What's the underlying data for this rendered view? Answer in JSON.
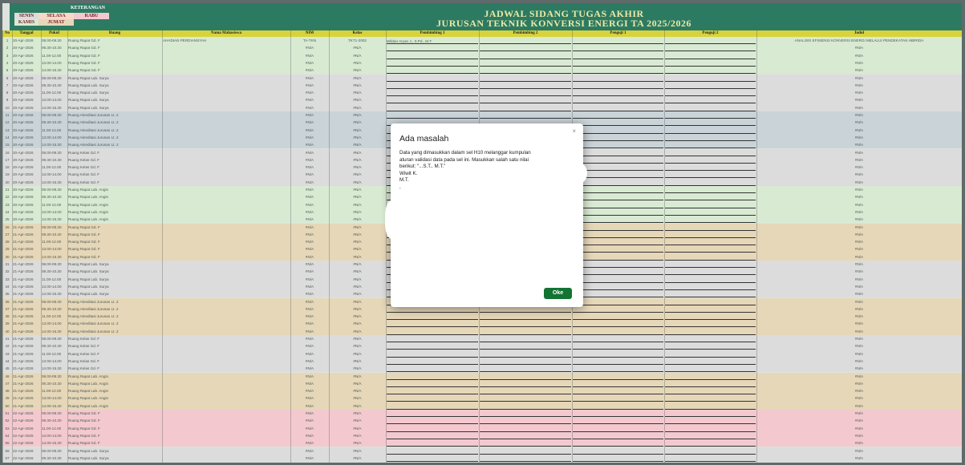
{
  "legend": {
    "title": "KETERANGAN",
    "days": [
      {
        "label": "SENIN",
        "color": "#dcdcdc"
      },
      {
        "label": "SELASA",
        "color": "#f6d9c7"
      },
      {
        "label": "RABU",
        "color": "#f3c9cf"
      },
      {
        "label": "KAMIS",
        "color": "#d9ead3"
      },
      {
        "label": "JUMAT",
        "color": "#e6d7b8"
      }
    ]
  },
  "sheet_title": {
    "line1": "JADWAL SIDANG TUGAS AKHIR",
    "line2": "JURUSAN TEKNIK KONVERSI ENERGI TA 2025/2026"
  },
  "columns": [
    "No",
    "Tanggal",
    "Pukul",
    "Ruang",
    "Nama Mahasiswa",
    "NIM",
    "Kelas",
    "Pembimbing 1",
    "Pembimbing 2",
    "Penguji 1",
    "Penguji 2",
    "Judul"
  ],
  "first_row": {
    "nama": "AHADIAN PERDIANSYAH",
    "nim": "TA-TKN",
    "kelas": "TKT1-2002",
    "pembimbing1": "Wildan Aryan J., S.Pd., M.T.",
    "judul": "ANALISIS EFISIENSI KONVERSI ENERGI MELALUI PENDEKATAN HIBRIDA"
  },
  "na_text": "#N/A",
  "rows": [
    {
      "no": "1",
      "tanggal": "20-Apr-2026",
      "pukul": "08.00-09.30",
      "ruang": "Ruang Rapat Gd. F",
      "color": "#d9ead3"
    },
    {
      "no": "2",
      "tanggal": "20-Apr-2026",
      "pukul": "09.30-10.30",
      "ruang": "Ruang Rapat Gd. F",
      "color": "#d9ead3"
    },
    {
      "no": "3",
      "tanggal": "20-Apr-2026",
      "pukul": "11.00-12.00",
      "ruang": "Ruang Rapat Gd. F",
      "color": "#d9ead3"
    },
    {
      "no": "4",
      "tanggal": "20-Apr-2026",
      "pukul": "13.00-14.00",
      "ruang": "Ruang Rapat Gd. F",
      "color": "#d9ead3"
    },
    {
      "no": "5",
      "tanggal": "20-Apr-2026",
      "pukul": "14.00-15.30",
      "ruang": "Ruang Rapat Gd. F",
      "color": "#d9ead3"
    },
    {
      "no": "6",
      "tanggal": "20-Apr-2026",
      "pukul": "08.00-09.30",
      "ruang": "Ruang Rapat Lab. Surya",
      "color": "#dcdcdc"
    },
    {
      "no": "7",
      "tanggal": "20-Apr-2026",
      "pukul": "09.30-10.30",
      "ruang": "Ruang Rapat Lab. Surya",
      "color": "#dcdcdc"
    },
    {
      "no": "8",
      "tanggal": "20-Apr-2026",
      "pukul": "11.00-12.00",
      "ruang": "Ruang Rapat Lab. Surya",
      "color": "#dcdcdc"
    },
    {
      "no": "9",
      "tanggal": "20-Apr-2026",
      "pukul": "13.00-14.00",
      "ruang": "Ruang Rapat Lab. Surya",
      "color": "#dcdcdc"
    },
    {
      "no": "10",
      "tanggal": "20-Apr-2026",
      "pukul": "14.00-15.30",
      "ruang": "Ruang Rapat Lab. Surya",
      "color": "#dcdcdc"
    },
    {
      "no": "11",
      "tanggal": "20-Apr-2026",
      "pukul": "08.00-09.30",
      "ruang": "Ruang Akreditasi Jurusan Lt. 2",
      "color": "#c9d3d8"
    },
    {
      "no": "12",
      "tanggal": "20-Apr-2026",
      "pukul": "09.30-10.30",
      "ruang": "Ruang Akreditasi Jurusan Lt. 2",
      "color": "#c9d3d8"
    },
    {
      "no": "13",
      "tanggal": "20-Apr-2026",
      "pukul": "11.00-12.00",
      "ruang": "Ruang Akreditasi Jurusan Lt. 2",
      "color": "#c9d3d8"
    },
    {
      "no": "14",
      "tanggal": "20-Apr-2026",
      "pukul": "13.00-14.00",
      "ruang": "Ruang Akreditasi Jurusan Lt. 2",
      "color": "#c9d3d8"
    },
    {
      "no": "15",
      "tanggal": "20-Apr-2026",
      "pukul": "14.00-15.30",
      "ruang": "Ruang Akreditasi Jurusan Lt. 2",
      "color": "#c9d3d8"
    },
    {
      "no": "16",
      "tanggal": "20-Apr-2026",
      "pukul": "08.00-09.30",
      "ruang": "Ruang Kelas Gd. F",
      "color": "#dcdcdc"
    },
    {
      "no": "17",
      "tanggal": "20-Apr-2026",
      "pukul": "09.30-10.30",
      "ruang": "Ruang Kelas Gd. F",
      "color": "#dcdcdc"
    },
    {
      "no": "18",
      "tanggal": "20-Apr-2026",
      "pukul": "11.00-12.00",
      "ruang": "Ruang Kelas Gd. F",
      "color": "#dcdcdc"
    },
    {
      "no": "19",
      "tanggal": "20-Apr-2026",
      "pukul": "13.00-14.00",
      "ruang": "Ruang Kelas Gd. F",
      "color": "#dcdcdc"
    },
    {
      "no": "20",
      "tanggal": "20-Apr-2026",
      "pukul": "14.00-15.30",
      "ruang": "Ruang Kelas Gd. F",
      "color": "#dcdcdc"
    },
    {
      "no": "21",
      "tanggal": "20-Apr-2026",
      "pukul": "08.00-09.30",
      "ruang": "Ruang Rapat Lab. Angin",
      "color": "#d9ead3"
    },
    {
      "no": "22",
      "tanggal": "20-Apr-2026",
      "pukul": "09.30-10.30",
      "ruang": "Ruang Rapat Lab. Angin",
      "color": "#d9ead3"
    },
    {
      "no": "23",
      "tanggal": "20-Apr-2026",
      "pukul": "11.00-12.00",
      "ruang": "Ruang Rapat Lab. Angin",
      "color": "#d9ead3"
    },
    {
      "no": "24",
      "tanggal": "20-Apr-2026",
      "pukul": "13.00-14.00",
      "ruang": "Ruang Rapat Lab. Angin",
      "color": "#d9ead3"
    },
    {
      "no": "25",
      "tanggal": "20-Apr-2026",
      "pukul": "14.00-15.30",
      "ruang": "Ruang Rapat Lab. Angin",
      "color": "#d9ead3"
    },
    {
      "no": "26",
      "tanggal": "21-Apr-2026",
      "pukul": "08.00-09.30",
      "ruang": "Ruang Rapat Gd. F",
      "color": "#e6d7b8"
    },
    {
      "no": "27",
      "tanggal": "21-Apr-2026",
      "pukul": "09.30-10.30",
      "ruang": "Ruang Rapat Gd. F",
      "color": "#e6d7b8"
    },
    {
      "no": "28",
      "tanggal": "21-Apr-2026",
      "pukul": "11.00-12.00",
      "ruang": "Ruang Rapat Gd. F",
      "color": "#e6d7b8"
    },
    {
      "no": "29",
      "tanggal": "21-Apr-2026",
      "pukul": "13.00-14.00",
      "ruang": "Ruang Rapat Gd. F",
      "color": "#e6d7b8"
    },
    {
      "no": "30",
      "tanggal": "21-Apr-2026",
      "pukul": "14.00-15.30",
      "ruang": "Ruang Rapat Gd. F",
      "color": "#e6d7b8"
    },
    {
      "no": "31",
      "tanggal": "21-Apr-2026",
      "pukul": "08.00-09.30",
      "ruang": "Ruang Rapat Lab. Surya",
      "color": "#dcdcdc"
    },
    {
      "no": "32",
      "tanggal": "21-Apr-2026",
      "pukul": "09.30-10.30",
      "ruang": "Ruang Rapat Lab. Surya",
      "color": "#dcdcdc"
    },
    {
      "no": "33",
      "tanggal": "21-Apr-2026",
      "pukul": "11.00-12.00",
      "ruang": "Ruang Rapat Lab. Surya",
      "color": "#dcdcdc"
    },
    {
      "no": "34",
      "tanggal": "21-Apr-2026",
      "pukul": "13.00-14.00",
      "ruang": "Ruang Rapat Lab. Surya",
      "color": "#dcdcdc"
    },
    {
      "no": "35",
      "tanggal": "21-Apr-2026",
      "pukul": "14.00-15.30",
      "ruang": "Ruang Rapat Lab. Surya",
      "color": "#dcdcdc"
    },
    {
      "no": "36",
      "tanggal": "21-Apr-2026",
      "pukul": "08.00-09.30",
      "ruang": "Ruang Akreditasi Jurusan Lt. 2",
      "color": "#e6d7b8"
    },
    {
      "no": "37",
      "tanggal": "21-Apr-2026",
      "pukul": "09.30-10.30",
      "ruang": "Ruang Akreditasi Jurusan Lt. 2",
      "color": "#e6d7b8"
    },
    {
      "no": "38",
      "tanggal": "21-Apr-2026",
      "pukul": "11.00-12.00",
      "ruang": "Ruang Akreditasi Jurusan Lt. 2",
      "color": "#e6d7b8"
    },
    {
      "no": "39",
      "tanggal": "21-Apr-2026",
      "pukul": "13.00-14.00",
      "ruang": "Ruang Akreditasi Jurusan Lt. 2",
      "color": "#e6d7b8"
    },
    {
      "no": "40",
      "tanggal": "21-Apr-2026",
      "pukul": "14.00-15.30",
      "ruang": "Ruang Akreditasi Jurusan Lt. 2",
      "color": "#e6d7b8"
    },
    {
      "no": "41",
      "tanggal": "21-Apr-2026",
      "pukul": "08.00-09.30",
      "ruang": "Ruang Kelas Gd. F",
      "color": "#dcdcdc"
    },
    {
      "no": "42",
      "tanggal": "21-Apr-2026",
      "pukul": "09.30-10.30",
      "ruang": "Ruang Kelas Gd. F",
      "color": "#dcdcdc"
    },
    {
      "no": "43",
      "tanggal": "21-Apr-2026",
      "pukul": "11.00-12.00",
      "ruang": "Ruang Kelas Gd. F",
      "color": "#dcdcdc"
    },
    {
      "no": "44",
      "tanggal": "21-Apr-2026",
      "pukul": "13.00-14.00",
      "ruang": "Ruang Kelas Gd. F",
      "color": "#dcdcdc"
    },
    {
      "no": "45",
      "tanggal": "21-Apr-2026",
      "pukul": "14.00-15.30",
      "ruang": "Ruang Kelas Gd. F",
      "color": "#dcdcdc"
    },
    {
      "no": "46",
      "tanggal": "21-Apr-2026",
      "pukul": "08.00-09.30",
      "ruang": "Ruang Rapat Lab. Angin",
      "color": "#e6d7b8"
    },
    {
      "no": "47",
      "tanggal": "21-Apr-2026",
      "pukul": "09.30-10.30",
      "ruang": "Ruang Rapat Lab. Angin",
      "color": "#e6d7b8"
    },
    {
      "no": "48",
      "tanggal": "21-Apr-2026",
      "pukul": "11.00-12.00",
      "ruang": "Ruang Rapat Lab. Angin",
      "color": "#e6d7b8"
    },
    {
      "no": "49",
      "tanggal": "21-Apr-2026",
      "pukul": "13.00-14.00",
      "ruang": "Ruang Rapat Lab. Angin",
      "color": "#e6d7b8"
    },
    {
      "no": "50",
      "tanggal": "21-Apr-2026",
      "pukul": "14.00-15.30",
      "ruang": "Ruang Rapat Lab. Angin",
      "color": "#e6d7b8"
    },
    {
      "no": "51",
      "tanggal": "22-Apr-2026",
      "pukul": "08.00-09.30",
      "ruang": "Ruang Rapat Gd. F",
      "color": "#f3c9cf"
    },
    {
      "no": "52",
      "tanggal": "22-Apr-2026",
      "pukul": "09.30-10.30",
      "ruang": "Ruang Rapat Gd. F",
      "color": "#f3c9cf"
    },
    {
      "no": "53",
      "tanggal": "22-Apr-2026",
      "pukul": "11.00-12.00",
      "ruang": "Ruang Rapat Gd. F",
      "color": "#f3c9cf"
    },
    {
      "no": "54",
      "tanggal": "22-Apr-2026",
      "pukul": "13.00-14.00",
      "ruang": "Ruang Rapat Gd. F",
      "color": "#f3c9cf"
    },
    {
      "no": "55",
      "tanggal": "22-Apr-2026",
      "pukul": "14.00-15.30",
      "ruang": "Ruang Rapat Gd. F",
      "color": "#f3c9cf"
    },
    {
      "no": "56",
      "tanggal": "22-Apr-2026",
      "pukul": "08.00-09.30",
      "ruang": "Ruang Rapat Lab. Surya",
      "color": "#dcdcdc"
    },
    {
      "no": "57",
      "tanggal": "22-Apr-2026",
      "pukul": "09.30-10.30",
      "ruang": "Ruang Rapat Lab. Surya",
      "color": "#dcdcdc"
    }
  ],
  "dialog": {
    "title": "Ada masalah",
    "close": "×",
    "message_lines": [
      "Data yang dimasukkan dalam sel H10 melanggar kumpulan",
      "aturan validasi data pada sel ini. Masukkan salah satu nilai",
      "berikut: \"...S.T., M.T.\"",
      "Wiwit K.",
      "M.T.",
      ","
    ],
    "ok": "Oke"
  }
}
